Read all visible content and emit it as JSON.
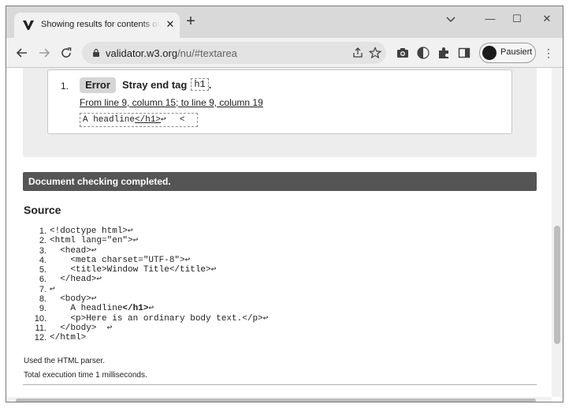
{
  "browser": {
    "tab_title": "Showing results for contents of text-input area",
    "tab_close": "✕",
    "new_tab": "+",
    "window_controls": {
      "minimize": "—",
      "restore": "☐",
      "close": "✕"
    },
    "url_host": "validator.w3.org",
    "url_path": "/nu/#textarea",
    "profile_label": "Pausiert",
    "menu": "⋮"
  },
  "results": {
    "message_number": "1.",
    "badge": "Error",
    "message_text": "Stray end tag",
    "message_code": "h1",
    "message_end": ".",
    "location": "From line 9, column 15; to line 9, column 19",
    "extract_pre": "A headline",
    "extract_hl": "</h1>",
    "extract_post": "↩",
    "extract_tail": "<"
  },
  "status_bar": "Document checking completed.",
  "source": {
    "heading": "Source",
    "lines": [
      {
        "num": "1.",
        "code": "<!doctype html>↩"
      },
      {
        "num": "2.",
        "code": "<html lang=\"en\">↩"
      },
      {
        "num": "3.",
        "code": "  <head>↩"
      },
      {
        "num": "4.",
        "code": "    <meta charset=\"UTF-8\">↩"
      },
      {
        "num": "5.",
        "code": "    <title>Window Title</title>↩"
      },
      {
        "num": "6.",
        "code": "  </head>↩"
      },
      {
        "num": "7.",
        "code": "↩"
      },
      {
        "num": "8.",
        "code": "  <body>↩"
      },
      {
        "num": "9.",
        "code_pre": "    A headline",
        "code_hl": "</h1>",
        "code_post": "↩"
      },
      {
        "num": "10.",
        "code": "    <p>Here is an ordinary body text.</p>↩"
      },
      {
        "num": "11.",
        "code": "  </body>  ↩"
      },
      {
        "num": "12.",
        "code": "</html>"
      }
    ]
  },
  "footer": {
    "parser": "Used the HTML parser.",
    "exec_time": "Total execution time 1 milliseconds."
  }
}
